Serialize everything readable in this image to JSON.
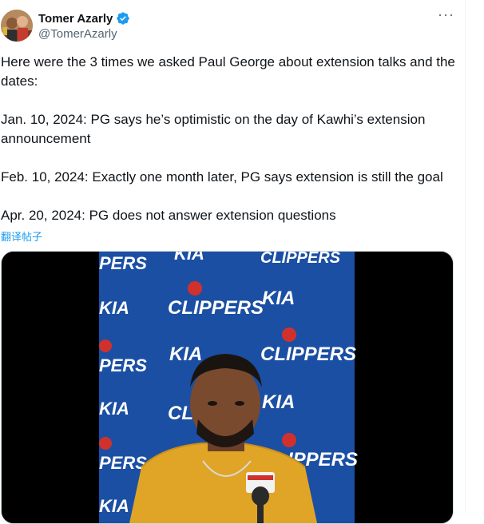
{
  "author": {
    "display_name": "Tomer Azarly",
    "handle": "@TomerAzarly",
    "verified_icon": "verified-badge-icon",
    "accent": "#1d9bf0"
  },
  "tweet": {
    "lines": [
      "Here were the 3 times we asked Paul George about extension talks and the dates:",
      "Jan. 10, 2024: PG says he’s optimistic on the day of Kawhi’s extension announcement",
      "Feb. 10, 2024: Exactly one month later, PG says extension is still the goal",
      "Apr. 20, 2024: PG does not answer extension questions"
    ],
    "translate_label": "翻译帖子"
  },
  "media": {
    "backdrop_brands": [
      "CLIPPERS",
      "KIA"
    ],
    "backdrop_color": "#1b4fa3",
    "shirt_color": "#e0a526"
  },
  "icons": {
    "more": "more-options-icon"
  }
}
